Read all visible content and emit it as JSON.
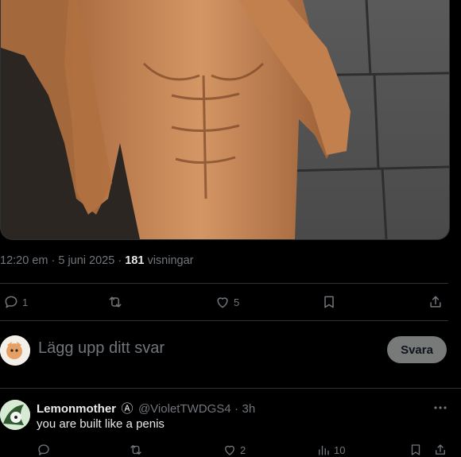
{
  "tweet": {
    "time": "12:20 em",
    "date": "5 juni 2025",
    "views_count": "181",
    "views_label": "visningar",
    "actions": {
      "replies": "1",
      "likes": "5"
    }
  },
  "composer": {
    "placeholder": "Lägg upp ditt svar",
    "button_label": "Svara"
  },
  "reply": {
    "display_name": "Lemonmother",
    "badge": "Ⓐ",
    "handle": "@VioletTWDGS4",
    "time": "3h",
    "text": "you are built like a penis",
    "actions": {
      "likes": "2",
      "views": "10"
    }
  },
  "colors": {
    "background": "#000000",
    "text": "#e7e9ea",
    "muted": "#71767b",
    "divider": "#2f3336",
    "button_disabled": "#787a7a"
  },
  "icons": [
    "reply-icon",
    "retweet-icon",
    "like-icon",
    "bookmark-icon",
    "share-icon",
    "more-icon",
    "views-icon"
  ]
}
